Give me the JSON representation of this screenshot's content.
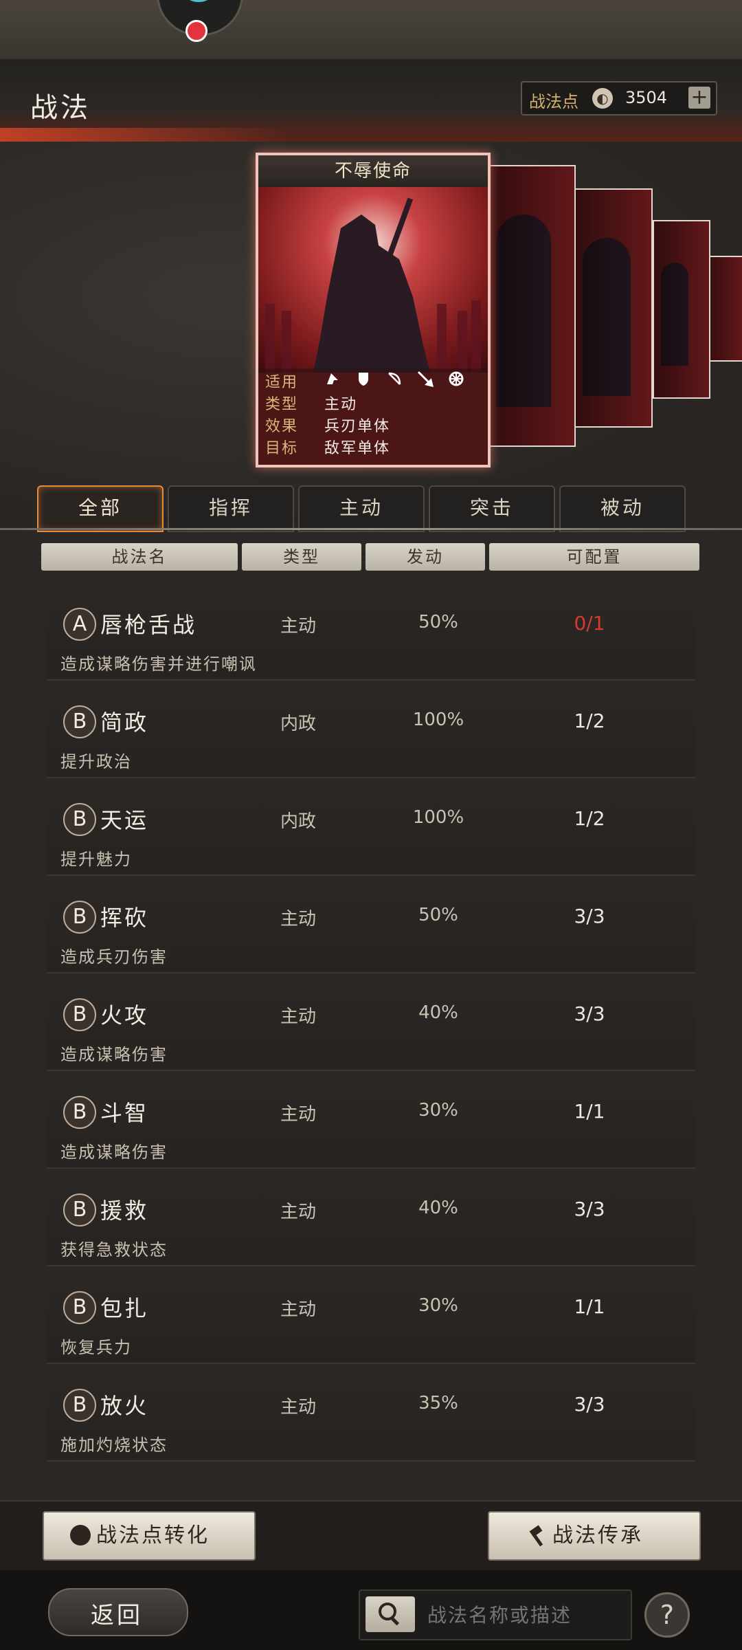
{
  "header": {
    "title": "战法",
    "points_label": "战法点",
    "points_value": "3504",
    "plus_label": "+"
  },
  "featured_card": {
    "name": "不辱使命",
    "rows": [
      {
        "key": "适用",
        "value": ""
      },
      {
        "key": "类型",
        "value": "主动"
      },
      {
        "key": "效果",
        "value": "兵刃单体"
      },
      {
        "key": "目标",
        "value": "敌军单体"
      }
    ],
    "unit_icons": [
      "cavalry-icon",
      "shield-icon",
      "bow-icon",
      "spear-icon",
      "wheel-icon"
    ]
  },
  "tabs": [
    "全部",
    "指挥",
    "主动",
    "突击",
    "被动"
  ],
  "columns": [
    "战法名",
    "类型",
    "发动",
    "可配置"
  ],
  "tactics": [
    {
      "grade": "A",
      "name": "唇枪舌战",
      "type": "主动",
      "rate": "50%",
      "config": "0/1",
      "desc": "造成谋略伤害并进行嘲讽",
      "config_red": true
    },
    {
      "grade": "B",
      "name": "简政",
      "type": "内政",
      "rate": "100%",
      "config": "1/2",
      "desc": "提升政治"
    },
    {
      "grade": "B",
      "name": "天运",
      "type": "内政",
      "rate": "100%",
      "config": "1/2",
      "desc": "提升魅力"
    },
    {
      "grade": "B",
      "name": "挥砍",
      "type": "主动",
      "rate": "50%",
      "config": "3/3",
      "desc": "造成兵刃伤害"
    },
    {
      "grade": "B",
      "name": "火攻",
      "type": "主动",
      "rate": "40%",
      "config": "3/3",
      "desc": "造成谋略伤害"
    },
    {
      "grade": "B",
      "name": "斗智",
      "type": "主动",
      "rate": "30%",
      "config": "1/1",
      "desc": "造成谋略伤害"
    },
    {
      "grade": "B",
      "name": "援救",
      "type": "主动",
      "rate": "40%",
      "config": "3/3",
      "desc": "获得急救状态"
    },
    {
      "grade": "B",
      "name": "包扎",
      "type": "主动",
      "rate": "30%",
      "config": "1/1",
      "desc": "恢复兵力"
    },
    {
      "grade": "B",
      "name": "放火",
      "type": "主动",
      "rate": "35%",
      "config": "3/3",
      "desc": "施加灼烧状态"
    }
  ],
  "buttons": {
    "convert": "战法点转化",
    "inherit": "战法传承",
    "back": "返回",
    "help": "?"
  },
  "search": {
    "placeholder": "战法名称或描述"
  }
}
